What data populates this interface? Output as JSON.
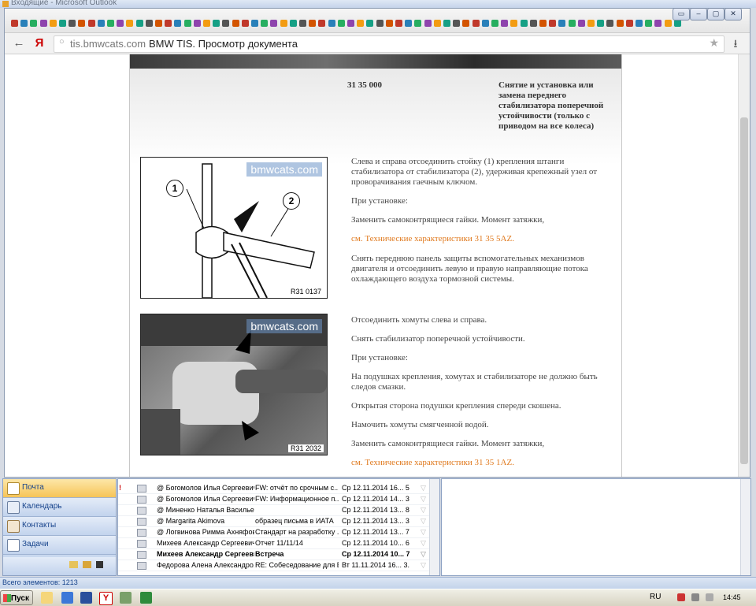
{
  "outlook": {
    "window_title": "Входящие - Microsoft Outlook",
    "nav": {
      "items": [
        {
          "label": "Почта",
          "selected": true,
          "icon": "mail-icon"
        },
        {
          "label": "Календарь",
          "selected": false,
          "icon": "calendar-icon"
        },
        {
          "label": "Контакты",
          "selected": false,
          "icon": "contacts-icon"
        },
        {
          "label": "Задачи",
          "selected": false,
          "icon": "tasks-icon"
        }
      ]
    },
    "mail_rows": [
      {
        "flag": "!",
        "from": "@ Богомолов Илья Сергеевич",
        "subject": "FW: отчёт по срочным с...",
        "date": "Ср 12.11.2014 16... 5...",
        "unread": false
      },
      {
        "flag": "",
        "from": "@ Богомолов Илья Сергеевич",
        "subject": "FW: Информационное п...",
        "date": "Ср 12.11.2014 14... 3...",
        "unread": false
      },
      {
        "flag": "",
        "from": "@ Миненко Наталья Васильевна",
        "subject": "",
        "date": "Ср 12.11.2014 13... 8...",
        "unread": false
      },
      {
        "flag": "",
        "from": "@ Margarita Akimova",
        "subject": "образец письма в ИАТА",
        "date": "Ср 12.11.2014 13... 3...",
        "unread": false
      },
      {
        "flag": "",
        "from": "@ Логвинова Римма Ахняфовна",
        "subject": "Стандарт на разработку ...",
        "date": "Ср 12.11.2014 13... 7...",
        "unread": false
      },
      {
        "flag": "",
        "from": "Михеев Александр Сергеевич",
        "subject": "Отчет 11/11/14",
        "date": "Ср 12.11.2014 10... 6...",
        "unread": false
      },
      {
        "flag": "",
        "from": "Михеев Александр Сергеевич",
        "subject": "Встреча",
        "date": "Ср 12.11.2014 10... 7...",
        "unread": true
      },
      {
        "flag": "",
        "from": "Федорова Алена Александро...",
        "subject": "RE: Собеседование для Б...",
        "date": "Вт 11.11.2014 16... 3...",
        "unread": false
      }
    ],
    "status": "Всего элементов: 1213"
  },
  "browser": {
    "url_domain": "tis.bmwcats.com",
    "tab_title": "BMW TIS. Просмотр документа",
    "back_label": "←",
    "yandex_label": "Я",
    "win_buttons": [
      "▭",
      "–",
      "▢",
      "✕"
    ]
  },
  "document": {
    "number": "31 35 000",
    "heading": "Снятие и установка или замена переднего стабилизатора поперечной устойчивости (только с приводом на все колеса)",
    "watermark": "bmwcats.com",
    "figure1": {
      "callout1": "1",
      "callout2": "2",
      "label": "R31 0137"
    },
    "figure2": {
      "label": "R31 2032"
    },
    "paragraphs1": [
      {
        "text": "Слева и справа отсоединить стойку (1) крепления штанги стабилизатора от стабилизатора (2), удерживая крепежный узел от проворачивания гаечным ключом.",
        "link": false
      },
      {
        "text": "При установке:",
        "link": false
      },
      {
        "text": "Заменить самоконтрящиеся гайки. Момент затяжки,",
        "link": false
      },
      {
        "text": "см. Технические характеристики 31 35 5AZ.",
        "link": true
      },
      {
        "text": "Снять переднюю панель защиты вспомогательных механизмов двигателя и отсоединить левую и правую направляющие потока охлаждающего воздуха тормозной системы.",
        "link": false
      }
    ],
    "paragraphs2": [
      {
        "text": "Отсоединить хомуты слева и справа.",
        "link": false
      },
      {
        "text": "Снять стабилизатор поперечной устойчивости.",
        "link": false
      },
      {
        "text": "При установке:",
        "link": false
      },
      {
        "text": "На подушках крепления, хомутах и стабилизаторе не должно быть следов смазки.",
        "link": false
      },
      {
        "text": "Открытая сторона подушки крепления спереди скошена.",
        "link": false
      },
      {
        "text": "Намочить хомуты смягченной водой.",
        "link": false
      },
      {
        "text": "Заменить самоконтрящиеся гайки. Момент затяжки,",
        "link": false
      },
      {
        "text": "см. Технические характеристики 31 35 1AZ.",
        "link": true
      }
    ]
  },
  "taskbar": {
    "start_label": "Пуск",
    "language": "RU",
    "clock": "14:45"
  },
  "colors": {
    "link": "#e07a1f",
    "nav_selected": "#f6c457",
    "outlook_blue": "#15428b"
  }
}
